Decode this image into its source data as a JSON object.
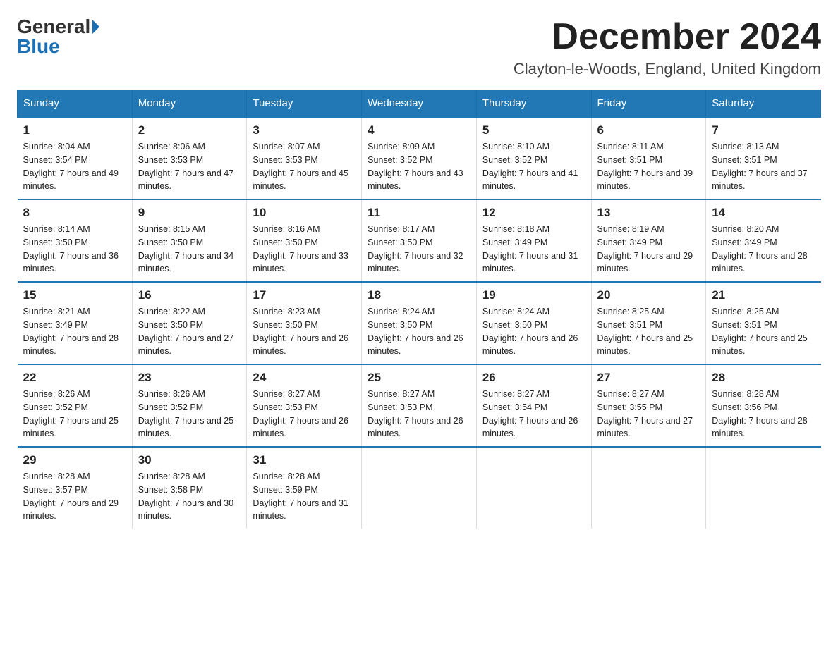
{
  "logo": {
    "general": "General",
    "blue": "Blue"
  },
  "title": {
    "month": "December 2024",
    "location": "Clayton-le-Woods, England, United Kingdom"
  },
  "headers": [
    "Sunday",
    "Monday",
    "Tuesday",
    "Wednesday",
    "Thursday",
    "Friday",
    "Saturday"
  ],
  "weeks": [
    [
      {
        "day": "1",
        "sunrise": "8:04 AM",
        "sunset": "3:54 PM",
        "daylight": "7 hours and 49 minutes."
      },
      {
        "day": "2",
        "sunrise": "8:06 AM",
        "sunset": "3:53 PM",
        "daylight": "7 hours and 47 minutes."
      },
      {
        "day": "3",
        "sunrise": "8:07 AM",
        "sunset": "3:53 PM",
        "daylight": "7 hours and 45 minutes."
      },
      {
        "day": "4",
        "sunrise": "8:09 AM",
        "sunset": "3:52 PM",
        "daylight": "7 hours and 43 minutes."
      },
      {
        "day": "5",
        "sunrise": "8:10 AM",
        "sunset": "3:52 PM",
        "daylight": "7 hours and 41 minutes."
      },
      {
        "day": "6",
        "sunrise": "8:11 AM",
        "sunset": "3:51 PM",
        "daylight": "7 hours and 39 minutes."
      },
      {
        "day": "7",
        "sunrise": "8:13 AM",
        "sunset": "3:51 PM",
        "daylight": "7 hours and 37 minutes."
      }
    ],
    [
      {
        "day": "8",
        "sunrise": "8:14 AM",
        "sunset": "3:50 PM",
        "daylight": "7 hours and 36 minutes."
      },
      {
        "day": "9",
        "sunrise": "8:15 AM",
        "sunset": "3:50 PM",
        "daylight": "7 hours and 34 minutes."
      },
      {
        "day": "10",
        "sunrise": "8:16 AM",
        "sunset": "3:50 PM",
        "daylight": "7 hours and 33 minutes."
      },
      {
        "day": "11",
        "sunrise": "8:17 AM",
        "sunset": "3:50 PM",
        "daylight": "7 hours and 32 minutes."
      },
      {
        "day": "12",
        "sunrise": "8:18 AM",
        "sunset": "3:49 PM",
        "daylight": "7 hours and 31 minutes."
      },
      {
        "day": "13",
        "sunrise": "8:19 AM",
        "sunset": "3:49 PM",
        "daylight": "7 hours and 29 minutes."
      },
      {
        "day": "14",
        "sunrise": "8:20 AM",
        "sunset": "3:49 PM",
        "daylight": "7 hours and 28 minutes."
      }
    ],
    [
      {
        "day": "15",
        "sunrise": "8:21 AM",
        "sunset": "3:49 PM",
        "daylight": "7 hours and 28 minutes."
      },
      {
        "day": "16",
        "sunrise": "8:22 AM",
        "sunset": "3:50 PM",
        "daylight": "7 hours and 27 minutes."
      },
      {
        "day": "17",
        "sunrise": "8:23 AM",
        "sunset": "3:50 PM",
        "daylight": "7 hours and 26 minutes."
      },
      {
        "day": "18",
        "sunrise": "8:24 AM",
        "sunset": "3:50 PM",
        "daylight": "7 hours and 26 minutes."
      },
      {
        "day": "19",
        "sunrise": "8:24 AM",
        "sunset": "3:50 PM",
        "daylight": "7 hours and 26 minutes."
      },
      {
        "day": "20",
        "sunrise": "8:25 AM",
        "sunset": "3:51 PM",
        "daylight": "7 hours and 25 minutes."
      },
      {
        "day": "21",
        "sunrise": "8:25 AM",
        "sunset": "3:51 PM",
        "daylight": "7 hours and 25 minutes."
      }
    ],
    [
      {
        "day": "22",
        "sunrise": "8:26 AM",
        "sunset": "3:52 PM",
        "daylight": "7 hours and 25 minutes."
      },
      {
        "day": "23",
        "sunrise": "8:26 AM",
        "sunset": "3:52 PM",
        "daylight": "7 hours and 25 minutes."
      },
      {
        "day": "24",
        "sunrise": "8:27 AM",
        "sunset": "3:53 PM",
        "daylight": "7 hours and 26 minutes."
      },
      {
        "day": "25",
        "sunrise": "8:27 AM",
        "sunset": "3:53 PM",
        "daylight": "7 hours and 26 minutes."
      },
      {
        "day": "26",
        "sunrise": "8:27 AM",
        "sunset": "3:54 PM",
        "daylight": "7 hours and 26 minutes."
      },
      {
        "day": "27",
        "sunrise": "8:27 AM",
        "sunset": "3:55 PM",
        "daylight": "7 hours and 27 minutes."
      },
      {
        "day": "28",
        "sunrise": "8:28 AM",
        "sunset": "3:56 PM",
        "daylight": "7 hours and 28 minutes."
      }
    ],
    [
      {
        "day": "29",
        "sunrise": "8:28 AM",
        "sunset": "3:57 PM",
        "daylight": "7 hours and 29 minutes."
      },
      {
        "day": "30",
        "sunrise": "8:28 AM",
        "sunset": "3:58 PM",
        "daylight": "7 hours and 30 minutes."
      },
      {
        "day": "31",
        "sunrise": "8:28 AM",
        "sunset": "3:59 PM",
        "daylight": "7 hours and 31 minutes."
      },
      null,
      null,
      null,
      null
    ]
  ]
}
